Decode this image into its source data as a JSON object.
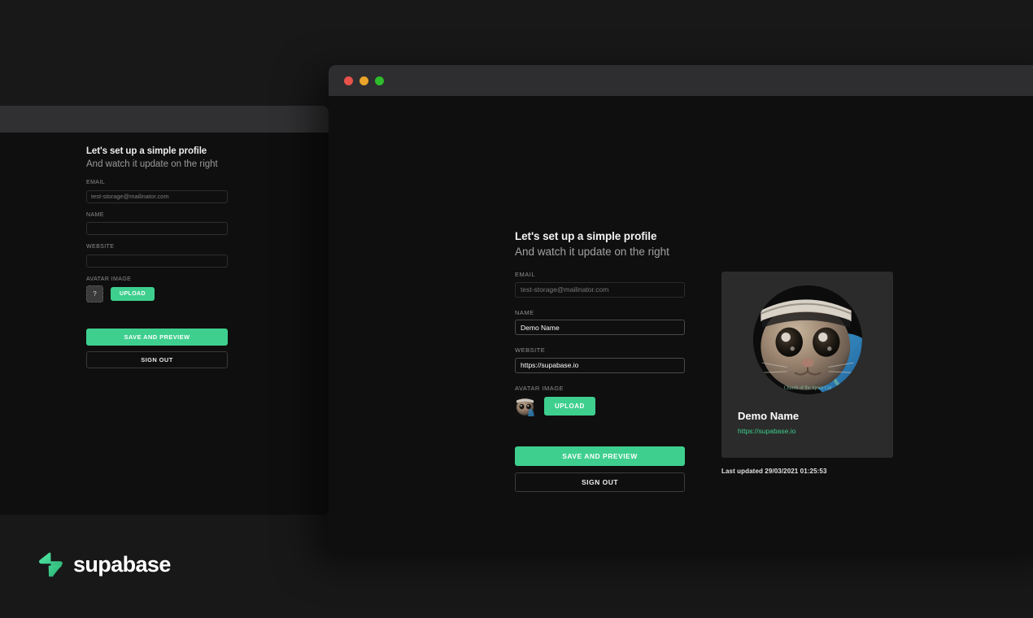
{
  "app": {
    "brand_name": "supabase",
    "background_color": "#181818",
    "accent_color": "#3ECF8E"
  },
  "window": {
    "traffic_lights": [
      {
        "name": "close",
        "color": "#E8524A"
      },
      {
        "name": "minimize",
        "color": "#E9A429"
      },
      {
        "name": "maximize",
        "color": "#2EBC2C"
      }
    ]
  },
  "form": {
    "heading": "Let's set up a simple profile",
    "subheading": "And watch it update on the right",
    "fields": [
      {
        "label": "EMAIL",
        "value": "test-storage@mailinator.com",
        "placeholder": "test-storage@mailinator.com",
        "disabled": true
      },
      {
        "label": "NAME",
        "value": "Demo Name",
        "placeholder": "Name",
        "disabled": false
      },
      {
        "label": "WEBSITE",
        "value": "https://supabase.io",
        "placeholder": "Website",
        "disabled": false
      }
    ],
    "avatar_label": "AVATAR IMAGE",
    "upload_label": "UPLOAD",
    "save_label": "SAVE AND PREVIEW",
    "signout_label": "SIGN OUT"
  },
  "preview": {
    "name": "Demo Name",
    "website": "https://supabase.io",
    "last_updated": "Last updated 29/03/2021 01:25:53",
    "card_color": "#2B2B2B"
  },
  "background_window": {
    "heading": "Let's set up a simple profile",
    "subheading": "And watch it update on the right",
    "fields": [
      {
        "label": "EMAIL",
        "value": "test-storage@mailinator.com"
      },
      {
        "label": "NAME",
        "value": ""
      },
      {
        "label": "WEBSITE",
        "value": ""
      }
    ],
    "avatar_label": "AVATAR IMAGE",
    "avatar_placeholder": "?",
    "upload_label": "UPLOAD",
    "save_label": "SAVE AND PREVIEW",
    "signout_label": "SIGN OUT"
  }
}
